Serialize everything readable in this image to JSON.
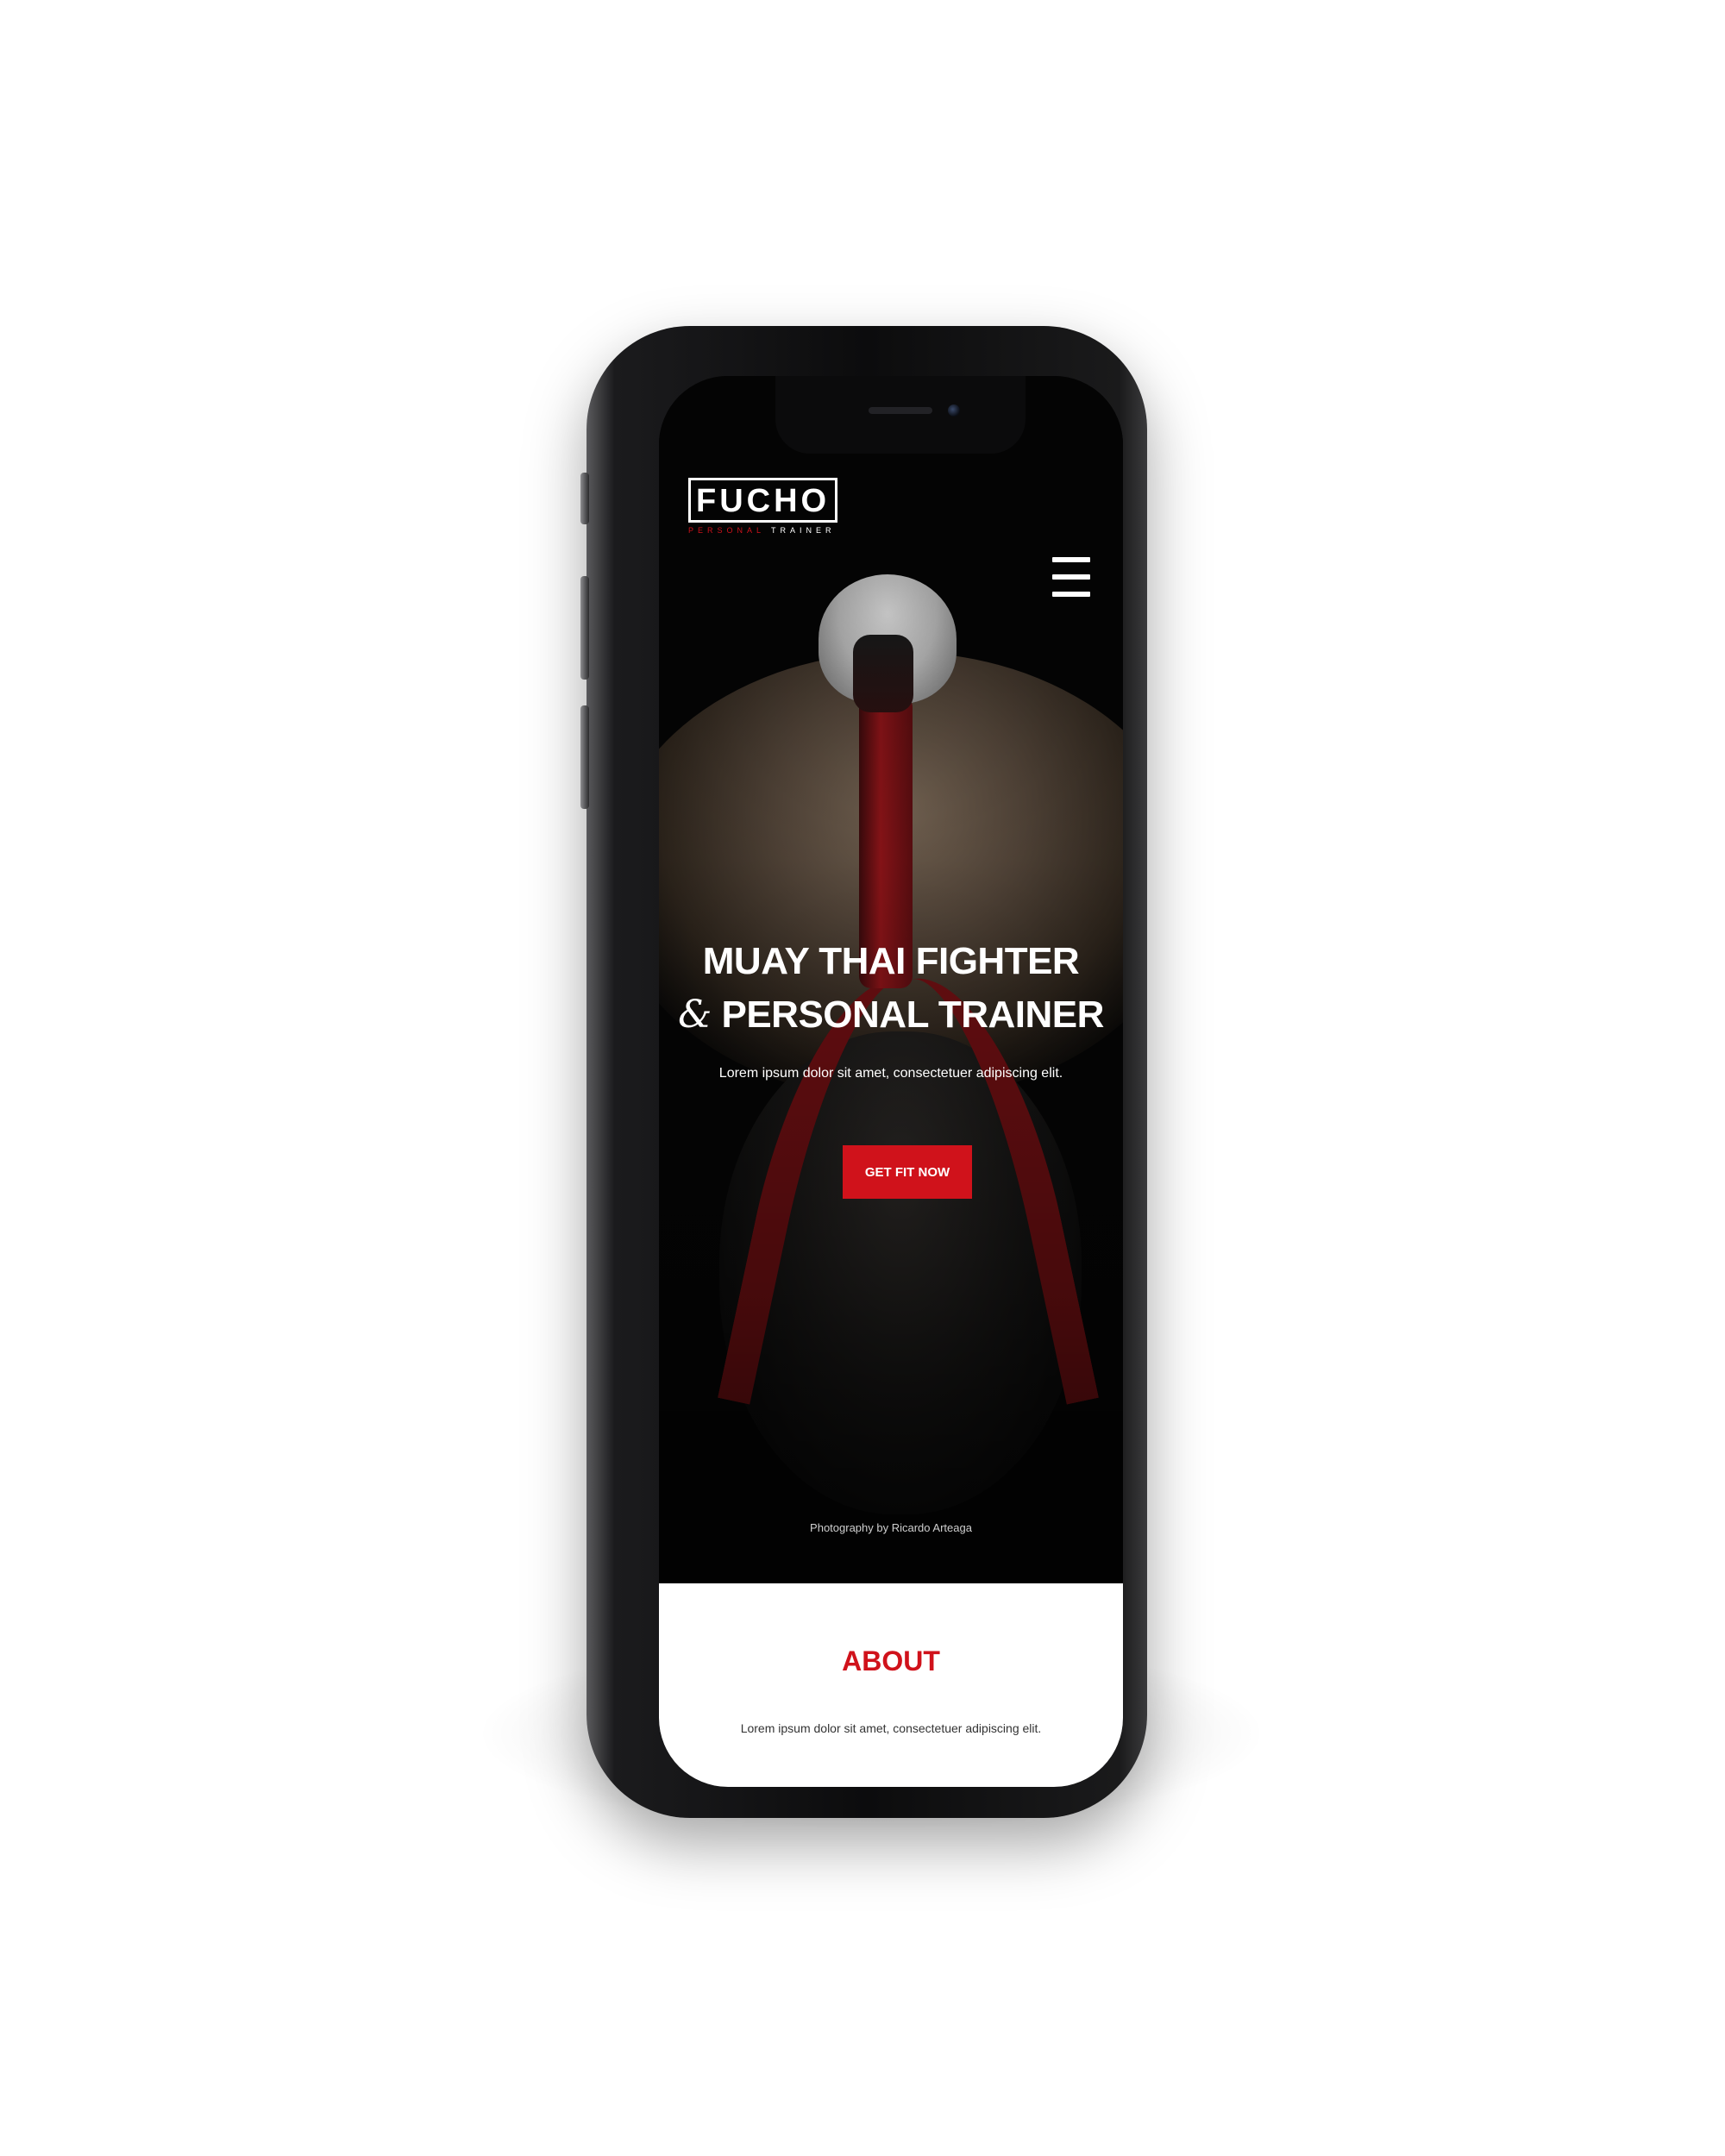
{
  "brand": {
    "logo_text": "FUCHO",
    "logo_sub_accent": "PERSONAL",
    "logo_sub_rest": "TRAINER"
  },
  "nav": {
    "menu_icon": "hamburger-menu-icon"
  },
  "hero": {
    "title_line1": "MUAY THAI FIGHTER",
    "title_amp": "&",
    "title_line2": "PERSONAL TRAINER",
    "subtitle": "Lorem ipsum dolor sit amet, consectetuer adipiscing elit.",
    "cta_label": "GET FIT NOW",
    "photo_credit": "Photography by Ricardo Arteaga"
  },
  "about": {
    "title": "ABOUT",
    "text": "Lorem ipsum dolor sit amet, consectetuer adipiscing elit."
  },
  "colors": {
    "accent": "#d0121b",
    "hero_background": "#050505",
    "text_light": "#ffffff"
  }
}
